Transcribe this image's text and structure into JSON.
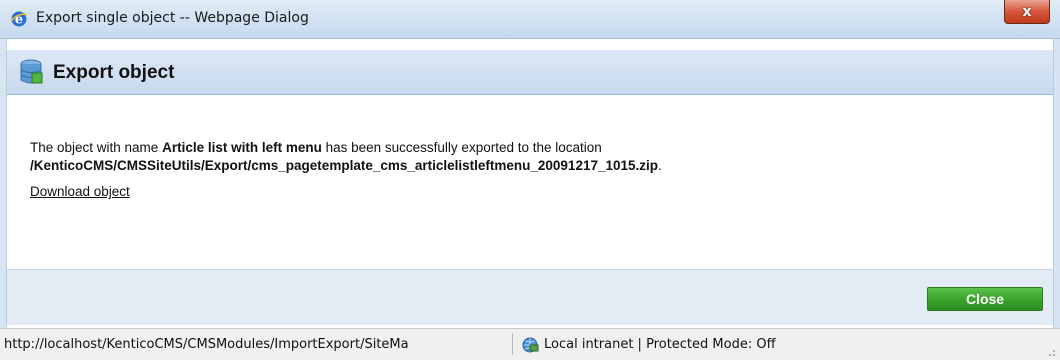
{
  "window": {
    "title": "Export single object -- Webpage Dialog",
    "close_glyph": "x"
  },
  "header": {
    "title": "Export object",
    "icon": "database-icon"
  },
  "message": {
    "prefix": "The object with name ",
    "object_name": "Article list with left menu",
    "suffix": " has been successfully exported to the location",
    "path": "/KenticoCMS/CMSSiteUtils/Export/cms_pagetemplate_cms_articlelistleftmenu_20091217_1015.zip",
    "path_end": "."
  },
  "download_link": "Download object",
  "footer": {
    "close_label": "Close"
  },
  "statusbar": {
    "url": "http://localhost/KenticoCMS/CMSModules/ImportExport/SiteMa",
    "zone": "Local intranet | Protected Mode: Off"
  },
  "colors": {
    "accent_green": "#3aa42d",
    "title_close_red": "#d5573c",
    "header_blue": "#c7d9ee"
  }
}
